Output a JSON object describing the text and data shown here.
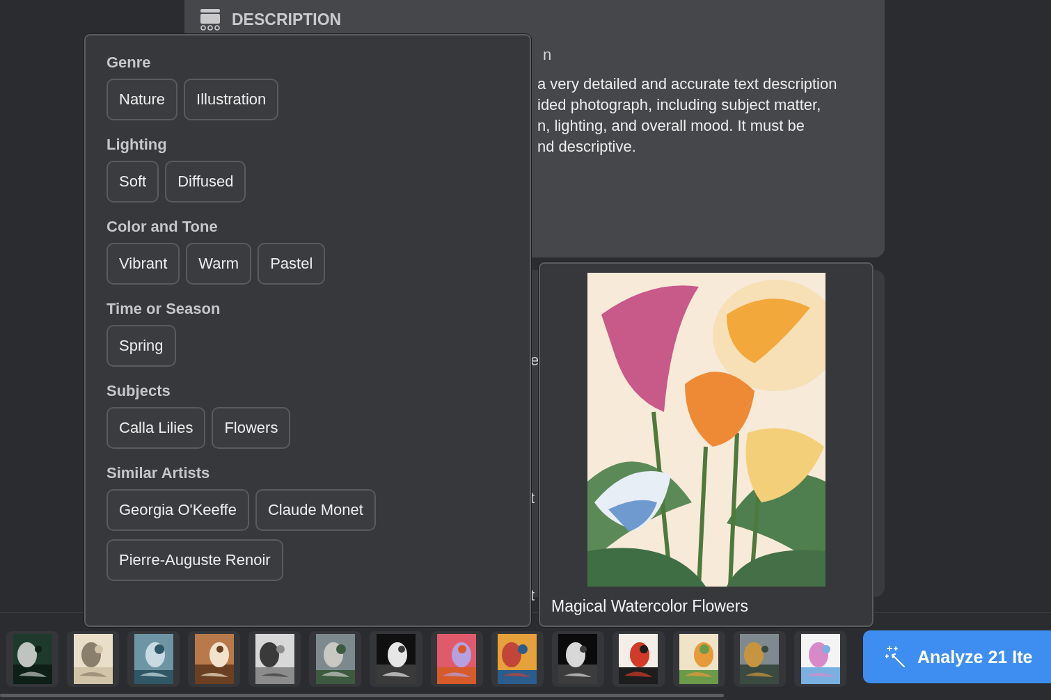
{
  "description_card": {
    "title": "DESCRIPTION",
    "heading_fragment": "n",
    "text_lines": [
      "a very detailed and accurate text description",
      "ided photograph, including subject matter,",
      "n, lighting, and overall mood. It must be",
      "nd descriptive."
    ]
  },
  "side_fragments": [
    {
      "text": "e"
    },
    {
      "text": "t"
    },
    {
      "text": "t"
    }
  ],
  "tags_popover": {
    "sections": [
      {
        "title": "Genre",
        "tags": [
          "Nature",
          "Illustration"
        ]
      },
      {
        "title": "Lighting",
        "tags": [
          "Soft",
          "Diffused"
        ]
      },
      {
        "title": "Color and Tone",
        "tags": [
          "Vibrant",
          "Warm",
          "Pastel"
        ]
      },
      {
        "title": "Time or Season",
        "tags": [
          "Spring"
        ]
      },
      {
        "title": "Subjects",
        "tags": [
          "Calla Lilies",
          "Flowers"
        ]
      },
      {
        "title": "Similar Artists",
        "tags": [
          "Georgia O'Keeffe",
          "Claude Monet",
          "Pierre-Auguste Renoir"
        ]
      }
    ]
  },
  "preview": {
    "caption": "Magical Watercolor Flowers"
  },
  "analyze_button": {
    "label": "Analyze 21 Ite"
  }
}
